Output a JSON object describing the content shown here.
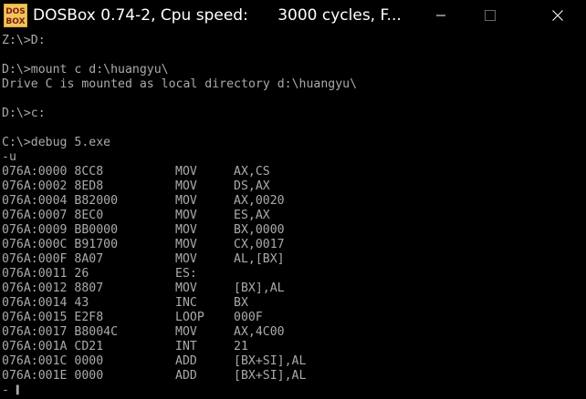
{
  "window": {
    "title": "DOSBox 0.74-2, Cpu speed:      3000 cycles, F...",
    "app_icon_text_top": "DOS",
    "app_icon_text_bottom": "BOX"
  },
  "terminal": {
    "text_lines": [
      "Z:\\>D:",
      "",
      "D:\\>mount c d:\\huangyu\\",
      "Drive C is mounted as local directory d:\\huangyu\\",
      "",
      "D:\\>c:",
      "",
      "C:\\>debug 5.exe",
      "-u"
    ],
    "disassembly": [
      {
        "addr": "076A:0000 8CC8",
        "op": "MOV",
        "arg": "AX,CS"
      },
      {
        "addr": "076A:0002 8ED8",
        "op": "MOV",
        "arg": "DS,AX"
      },
      {
        "addr": "076A:0004 B82000",
        "op": "MOV",
        "arg": "AX,0020"
      },
      {
        "addr": "076A:0007 8EC0",
        "op": "MOV",
        "arg": "ES,AX"
      },
      {
        "addr": "076A:0009 BB0000",
        "op": "MOV",
        "arg": "BX,0000"
      },
      {
        "addr": "076A:000C B91700",
        "op": "MOV",
        "arg": "CX,0017"
      },
      {
        "addr": "076A:000F 8A07",
        "op": "MOV",
        "arg": "AL,[BX]"
      },
      {
        "addr": "076A:0011 26",
        "op": "ES:",
        "arg": ""
      },
      {
        "addr": "076A:0012 8807",
        "op": "MOV",
        "arg": "[BX],AL"
      },
      {
        "addr": "076A:0014 43",
        "op": "INC",
        "arg": "BX"
      },
      {
        "addr": "076A:0015 E2F8",
        "op": "LOOP",
        "arg": "000F"
      },
      {
        "addr": "076A:0017 B8004C",
        "op": "MOV",
        "arg": "AX,4C00"
      },
      {
        "addr": "076A:001A CD21",
        "op": "INT",
        "arg": "21"
      },
      {
        "addr": "076A:001C 0000",
        "op": "ADD",
        "arg": "[BX+SI],AL"
      },
      {
        "addr": "076A:001E 0000",
        "op": "ADD",
        "arg": "[BX+SI],AL"
      }
    ],
    "prompt": "- ",
    "cursor_glyph": "▌"
  },
  "colors": {
    "terminal_text": "#aaaaaa",
    "background": "#000000",
    "title_text": "#ffffff"
  }
}
